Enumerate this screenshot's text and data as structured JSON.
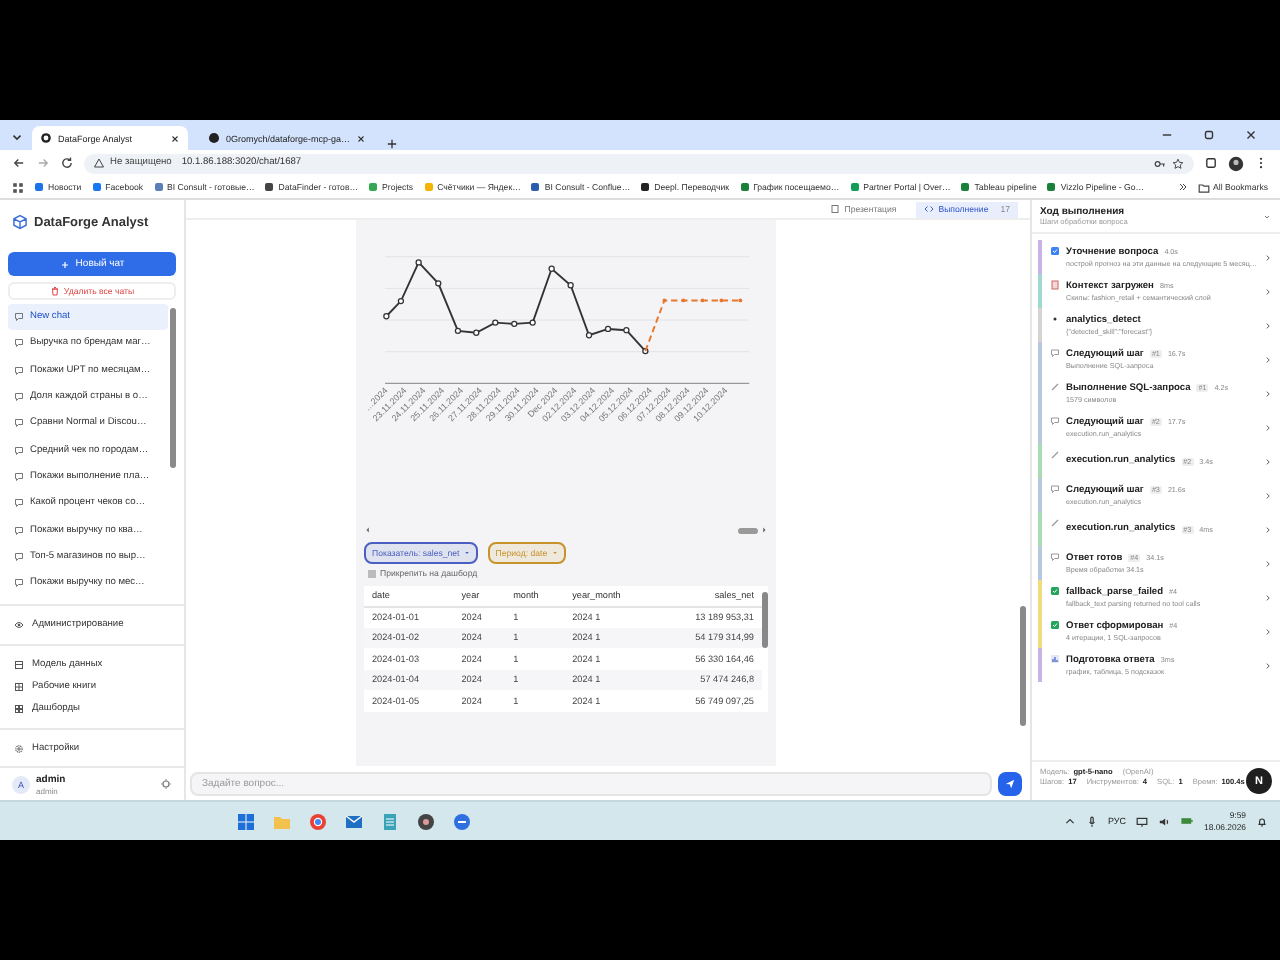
{
  "browser": {
    "tabs": [
      {
        "title": "DataForge Analyst",
        "selected": true
      },
      {
        "title": "0Gromych/dataforge-mcp-ga…",
        "selected": false
      }
    ],
    "security": "Не защищено",
    "url": "10.1.86.188:3020/chat/1687",
    "bookmarks": [
      {
        "label": "Новости",
        "color": "#1a73e8"
      },
      {
        "label": "Facebook",
        "color": "#1877f2"
      },
      {
        "label": "BI Consult - готовые…",
        "color": "#5b7fb8"
      },
      {
        "label": "DataFinder - готов…",
        "color": "#444444"
      },
      {
        "label": "Projects",
        "color": "#34a853"
      },
      {
        "label": "Счётчики — Яндек…",
        "color": "#f4b400"
      },
      {
        "label": "BI Consult - Confluе…",
        "color": "#2a5db0"
      },
      {
        "label": "Deepl. Переводчик",
        "color": "#222222"
      },
      {
        "label": "График посещаемо…",
        "color": "#188038"
      },
      {
        "label": "Partner Portal | Over…",
        "color": "#0f9d58"
      },
      {
        "label": "Tableau pipeline",
        "color": "#188038"
      },
      {
        "label": "Vizzlo Pipeline - Go…",
        "color": "#188038"
      }
    ],
    "all_bookmarks": "All Bookmarks"
  },
  "sidebar": {
    "brand": "DataForge Analyst",
    "new_chat": "Новый чат",
    "delete_all": "Удалить все чаты",
    "chats": [
      {
        "title": "New chat",
        "selected": true
      },
      {
        "title": "Выручка по брендам маг…",
        "selected": false
      },
      {
        "title": "Покажи UPT по месяцам…",
        "selected": false
      },
      {
        "title": "Доля каждой страны в о…",
        "selected": false
      },
      {
        "title": "Сравни Normal и Discou…",
        "selected": false
      },
      {
        "title": "Средний чек по городам…",
        "selected": false
      },
      {
        "title": "Покажи выполнение пла…",
        "selected": false
      },
      {
        "title": "Какой процент чеков со…",
        "selected": false
      },
      {
        "title": "Покажи выручку по ква…",
        "selected": false
      },
      {
        "title": "Топ-5 магазинов по выр…",
        "selected": false
      },
      {
        "title": "Покажи выручку по мес…",
        "selected": false
      }
    ],
    "admin": "Администрирование",
    "nav": [
      {
        "kind": "model",
        "label": "Модель данных"
      },
      {
        "kind": "books",
        "label": "Рабочие книги"
      },
      {
        "kind": "dash",
        "label": "Дашборды"
      }
    ],
    "settings": "Настройки",
    "user": {
      "initial": "A",
      "name": "admin",
      "role": "admin"
    }
  },
  "toolbar": {
    "tabs": [
      {
        "kind": "doc",
        "label": "Презентация",
        "selected": false
      },
      {
        "kind": "code",
        "label": "Выполнение",
        "badge": "17",
        "selected": true
      }
    ]
  },
  "chart": {
    "x_labels": [
      "…2024",
      "23.11.2024",
      "24.11.2024",
      "25.11.2024",
      "26.11.2024",
      "27.11.2024",
      "28.11.2024",
      "29.11.2024",
      "30.11.2024",
      "Dec 2024",
      "02.12.2024",
      "03.12.2024",
      "04.12.2024",
      "05.12.2024",
      "06.12.2024",
      "07.12.2024",
      "08.12.2024",
      "09.12.2024",
      "10.12.2024"
    ]
  },
  "chips": [
    {
      "label": "Показатель: sales_net",
      "color": "#4a5fc1"
    },
    {
      "label": "Период: date",
      "color": "#c7922a"
    }
  ],
  "pin": {
    "label": "Прикрепить на дашборд",
    "checked": false
  },
  "table": {
    "columns": [
      "date",
      "year",
      "month",
      "year_month",
      "sales_net"
    ],
    "rows": [
      [
        "2024-01-01",
        "2024",
        "1",
        "2024 1",
        "13 189 953,31"
      ],
      [
        "2024-01-02",
        "2024",
        "1",
        "2024 1",
        "54 179 314,99"
      ],
      [
        "2024-01-03",
        "2024",
        "1",
        "2024 1",
        "56 330 164,46"
      ],
      [
        "2024-01-04",
        "2024",
        "1",
        "2024 1",
        "57 474 246,8"
      ],
      [
        "2024-01-05",
        "2024",
        "1",
        "2024 1",
        "56 749 097,25"
      ]
    ]
  },
  "input": {
    "placeholder": "Задайте вопрос..."
  },
  "trace": {
    "title": "Ход выполнения",
    "subtitle": "Шаги обработки вопроса",
    "steps": [
      {
        "kind": "question",
        "title": "Уточнение вопроса",
        "badges": [
          "4.0s"
        ],
        "detail": "построй прогноз на эти данные на следующие 5 месяц…",
        "color": "#c9b3e6"
      },
      {
        "kind": "doc",
        "title": "Контекст загружен",
        "badges": [
          "8ms"
        ],
        "detail": "Скилы: fashion_retail + семантический слой",
        "color": "#9fd8cf"
      },
      {
        "kind": "dot",
        "title": "analytics_detect",
        "detail": "{\"detected_skill\":\"forecast\"}",
        "color": "#d4d4d4"
      },
      {
        "kind": "chat",
        "title": "Следующий шаг",
        "badges": [
          "#1",
          "16.7s"
        ],
        "detail": "Выполнение SQL-запроса",
        "color": "#b7c7dc"
      },
      {
        "kind": "tool",
        "title": "Выполнение SQL-запроса",
        "badges": [
          "#1",
          "4.2s"
        ],
        "detail": "1579 символов",
        "color": "#b7c7dc"
      },
      {
        "kind": "chat",
        "title": "Следующий шаг",
        "badges": [
          "#2",
          "17.7s"
        ],
        "detail": "execution.run_analytics",
        "color": "#b7c7dc"
      },
      {
        "kind": "tool",
        "title": "execution.run_analytics",
        "badges": [
          "#2",
          "3.4s"
        ],
        "color": "#a9dcb5"
      },
      {
        "kind": "chat",
        "title": "Следующий шаг",
        "badges": [
          "#3",
          "21.6s"
        ],
        "detail": "execution.run_analytics",
        "color": "#b7c7dc"
      },
      {
        "kind": "tool",
        "title": "execution.run_analytics",
        "badges": [
          "#3",
          "4ms"
        ],
        "color": "#a9dcb5"
      },
      {
        "kind": "chat",
        "title": "Ответ готов",
        "badges": [
          "#4",
          "34.1s"
        ],
        "detail": "Время обработки 34.1s",
        "color": "#b7c7dc"
      },
      {
        "kind": "done",
        "title": "fallback_parse_failed",
        "badges": [
          "#4"
        ],
        "detail": "fallback_text parsing returned no tool calls",
        "color": "#f0dc7a"
      },
      {
        "kind": "done",
        "title": "Ответ сформирован",
        "badges": [
          "#4"
        ],
        "detail": "4 итерации, 1 SQL-запросов",
        "color": "#f0dc7a"
      },
      {
        "kind": "chart",
        "title": "Подготовка ответа",
        "badges": [
          "3ms"
        ],
        "detail": "график, таблица, 5 подсказок",
        "color": "#c9b3e6"
      }
    ],
    "model_label": "Модель:",
    "model": "gpt-5-nano",
    "model_provider": "(OpenAI)",
    "stats": [
      {
        "label": "Шагов:",
        "value": "17"
      },
      {
        "label": "Инструментов:",
        "value": "4"
      },
      {
        "label": "SQL:",
        "value": "1"
      },
      {
        "label": "Время:",
        "value": "100.4s"
      }
    ],
    "fab": "N"
  },
  "taskbar": {
    "apps": [
      {
        "kind": "start"
      },
      {
        "kind": "folder"
      },
      {
        "kind": "browser"
      },
      {
        "kind": "mail"
      },
      {
        "kind": "notes"
      },
      {
        "kind": "disc"
      },
      {
        "kind": "app"
      }
    ],
    "lang": "РУС",
    "time": "9:59",
    "date": "18.06.2026"
  }
}
